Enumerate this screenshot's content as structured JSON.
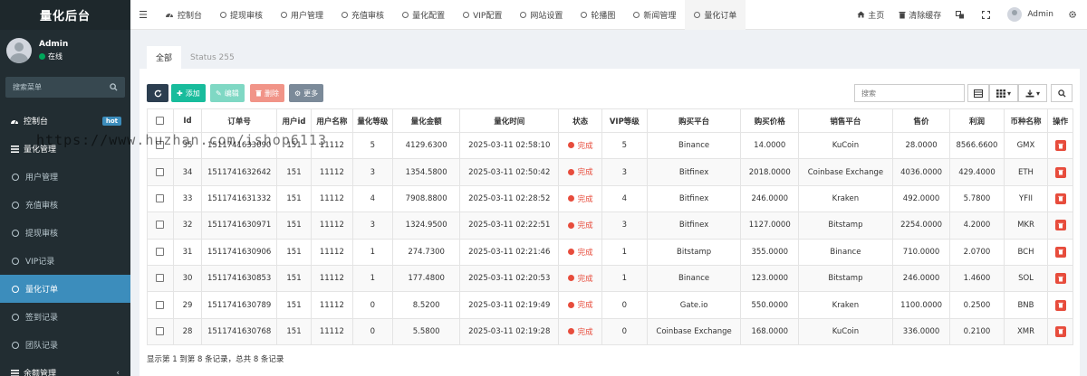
{
  "brand": "量化后台",
  "user": {
    "name": "Admin",
    "status": "在线"
  },
  "sidebar": {
    "search_placeholder": "搜索菜单",
    "items": [
      {
        "label": "控制台",
        "badge": "hot",
        "icon": "dashboard-icon"
      },
      {
        "label": "量化管理",
        "icon": "list-icon"
      },
      {
        "label": "用户管理"
      },
      {
        "label": "充值审核"
      },
      {
        "label": "提现审核"
      },
      {
        "label": "VIP记录"
      },
      {
        "label": "量化订单",
        "active": true
      },
      {
        "label": "签到记录"
      },
      {
        "label": "团队记录"
      },
      {
        "label": "余额管理",
        "icon": "list-icon"
      }
    ]
  },
  "topbar": {
    "tabs": [
      {
        "label": "控制台",
        "icon": "dashboard-icon"
      },
      {
        "label": "提现审核"
      },
      {
        "label": "用户管理"
      },
      {
        "label": "充值审核"
      },
      {
        "label": "量化配置"
      },
      {
        "label": "VIP配置"
      },
      {
        "label": "网站设置"
      },
      {
        "label": "轮播图"
      },
      {
        "label": "新闻管理"
      },
      {
        "label": "量化订单",
        "active": true
      }
    ],
    "right": {
      "home": "主页",
      "clear_cache": "清除缓存",
      "admin": "Admin"
    }
  },
  "content": {
    "tabs": [
      "全部",
      "Status 255"
    ],
    "toolbar": {
      "add": "添加",
      "edit": "编辑",
      "delete": "删除",
      "more": "更多",
      "search_placeholder": "搜索"
    },
    "columns": [
      "Id",
      "订单号",
      "用户id",
      "用户名称",
      "量化等级",
      "量化金额",
      "量化时间",
      "状态",
      "VIP等级",
      "购买平台",
      "购买价格",
      "销售平台",
      "售价",
      "利润",
      "币种名称",
      "操作"
    ],
    "rows": [
      [
        "35",
        "1511741633090",
        "151",
        "11112",
        "5",
        "4129.6300",
        "2025-03-11 02:58:10",
        "完成",
        "5",
        "Binance",
        "14.0000",
        "KuCoin",
        "28.0000",
        "8566.6600",
        "GMX"
      ],
      [
        "34",
        "1511741632642",
        "151",
        "11112",
        "3",
        "1354.5800",
        "2025-03-11 02:50:42",
        "完成",
        "3",
        "Bitfinex",
        "2018.0000",
        "Coinbase Exchange",
        "4036.0000",
        "429.4000",
        "ETH"
      ],
      [
        "33",
        "1511741631332",
        "151",
        "11112",
        "4",
        "7908.8800",
        "2025-03-11 02:28:52",
        "完成",
        "4",
        "Bitfinex",
        "246.0000",
        "Kraken",
        "492.0000",
        "5.7800",
        "YFII"
      ],
      [
        "32",
        "1511741630971",
        "151",
        "11112",
        "3",
        "1324.9500",
        "2025-03-11 02:22:51",
        "完成",
        "3",
        "Bitfinex",
        "1127.0000",
        "Bitstamp",
        "2254.0000",
        "4.2000",
        "MKR"
      ],
      [
        "31",
        "1511741630906",
        "151",
        "11112",
        "1",
        "274.7300",
        "2025-03-11 02:21:46",
        "完成",
        "1",
        "Bitstamp",
        "355.0000",
        "Binance",
        "710.0000",
        "2.0700",
        "BCH"
      ],
      [
        "30",
        "1511741630853",
        "151",
        "11112",
        "1",
        "177.4800",
        "2025-03-11 02:20:53",
        "完成",
        "1",
        "Binance",
        "123.0000",
        "Bitstamp",
        "246.0000",
        "1.4600",
        "SOL"
      ],
      [
        "29",
        "1511741630789",
        "151",
        "11112",
        "0",
        "8.5200",
        "2025-03-11 02:19:49",
        "完成",
        "0",
        "Gate.io",
        "550.0000",
        "Kraken",
        "1100.0000",
        "0.2500",
        "BNB"
      ],
      [
        "28",
        "1511741630768",
        "151",
        "11112",
        "0",
        "5.5800",
        "2025-03-11 02:19:28",
        "完成",
        "0",
        "Coinbase Exchange",
        "168.0000",
        "KuCoin",
        "336.0000",
        "0.2100",
        "XMR"
      ]
    ],
    "footer": "显示第 1 到第 8 条记录，总共 8 条记录"
  },
  "watermark": "https://www.huzhan.com/ishop6113",
  "colors": {
    "sidebar_bg": "#222d32",
    "accent": "#3c8dbc",
    "success": "#18bc9c",
    "danger": "#e74c3c",
    "dark_btn": "#2c3e50"
  }
}
